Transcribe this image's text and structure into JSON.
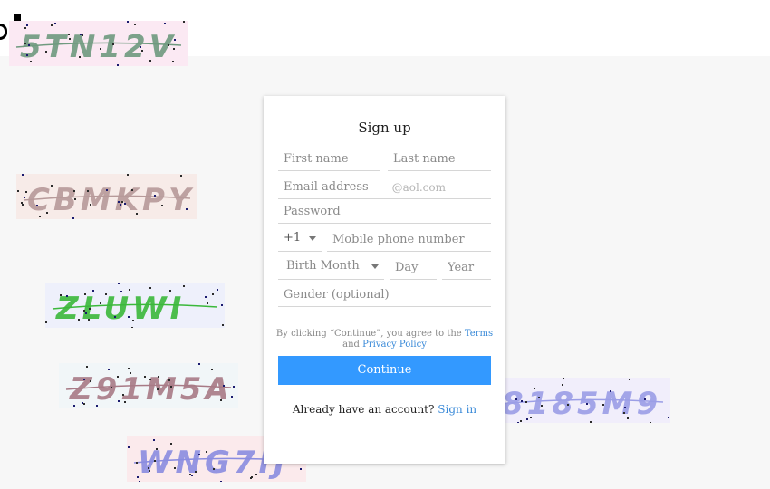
{
  "form": {
    "title": "Sign up",
    "first_name_placeholder": "First name",
    "last_name_placeholder": "Last name",
    "email_placeholder": "Email address",
    "email_suffix": "@aol.com",
    "password_placeholder": "Password",
    "country_code": "+1",
    "mobile_placeholder": "Mobile phone number",
    "birth_month_label": "Birth Month",
    "day_placeholder": "Day",
    "year_placeholder": "Year",
    "gender_placeholder": "Gender (optional)",
    "terms_prefix": "By clicking “Continue”, you agree to the",
    "terms_link": "Terms",
    "terms_and": "and",
    "privacy_link": "Privacy Policy",
    "continue_label": "Continue",
    "already_text": "Already have an account?",
    "signin_link": "Sign in"
  },
  "colors": {
    "accent": "#3399ff",
    "link": "#3a8ad8"
  },
  "captchas": [
    {
      "text": "5TN12V",
      "bg": "#fbe9f3",
      "fg": "#6f9a7f"
    },
    {
      "text": "CBMKPY",
      "bg": "#f7ebe8",
      "fg": "#b79a9a"
    },
    {
      "text": "ZLUWI",
      "bg": "#eef0fb",
      "fg": "#3bb83b"
    },
    {
      "text": "Z91M5A",
      "bg": "#f1f6f8",
      "fg": "#a87a86"
    },
    {
      "text": "8185M9",
      "bg": "#f1eefb",
      "fg": "#9b9ee6"
    },
    {
      "text": "WNG7IJ",
      "bg": "#fbeaec",
      "fg": "#8a8ce0"
    }
  ]
}
